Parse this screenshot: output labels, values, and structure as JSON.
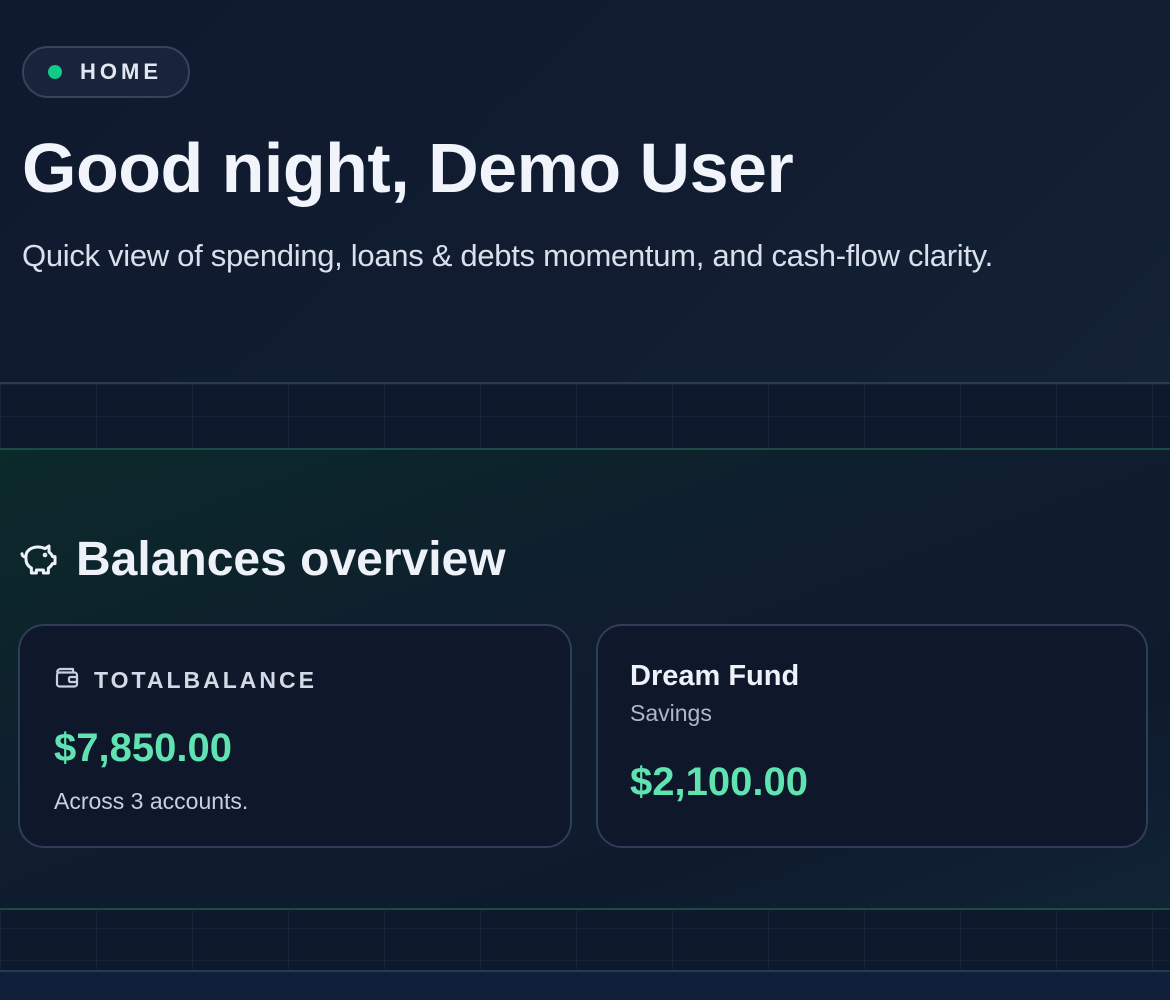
{
  "hero": {
    "badge": "HOME",
    "title": "Good night, Demo User",
    "subtitle": "Quick view of spending, loans & debts momentum, and cash-flow clarity."
  },
  "balances": {
    "section_title": "Balances overview",
    "section_icon": "piggy-bank-icon",
    "total_card": {
      "icon": "wallet-icon",
      "label": "TOTALBALANCE",
      "amount": "$7,850.00",
      "note": "Across 3 accounts."
    },
    "accounts": [
      {
        "name": "Dream Fund",
        "type": "Savings",
        "amount": "$2,100.00"
      }
    ]
  },
  "colors": {
    "accent_green": "#10c98a",
    "amount_green": "#5fe3b0",
    "background": "#0d1526"
  }
}
